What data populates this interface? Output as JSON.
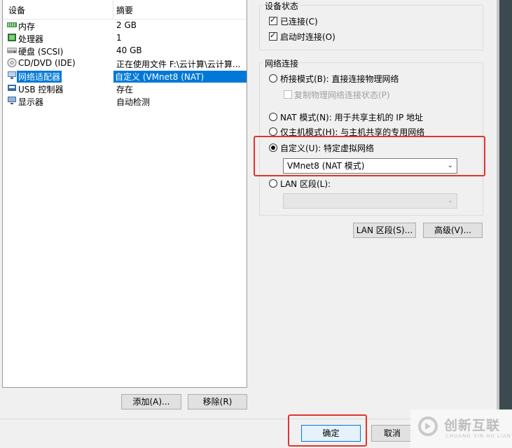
{
  "device_list": {
    "header_device": "设备",
    "header_summary": "摘要",
    "rows": [
      {
        "device": "内存",
        "summary": "2 GB",
        "icon": "memory-icon"
      },
      {
        "device": "处理器",
        "summary": "1",
        "icon": "processor-icon"
      },
      {
        "device": "硬盘 (SCSI)",
        "summary": "40 GB",
        "icon": "hard-disk-icon"
      },
      {
        "device": "CD/DVD (IDE)",
        "summary": "正在使用文件 F:\\云计算\\云计算...",
        "icon": "cd-dvd-icon"
      },
      {
        "device": "网络适配器",
        "summary": "自定义 (VMnet8 (NAT)",
        "icon": "network-adapter-icon",
        "selected": true
      },
      {
        "device": "USB 控制器",
        "summary": "存在",
        "icon": "usb-icon"
      },
      {
        "device": "显示器",
        "summary": "自动检测",
        "icon": "display-icon"
      }
    ],
    "add_button": "添加(A)...",
    "remove_button": "移除(R)"
  },
  "device_status": {
    "title": "设备状态",
    "connected": {
      "label": "已连接(C)",
      "checked": true
    },
    "connect_at_power_on": {
      "label": "启动时连接(O)",
      "checked": true
    }
  },
  "network_connection": {
    "title": "网络连接",
    "bridged": {
      "label": "桥接模式(B): 直接连接物理网络",
      "selected": false
    },
    "replicate": {
      "label": "复制物理网络连接状态(P)",
      "checked": false,
      "disabled": true
    },
    "nat": {
      "label": "NAT 模式(N): 用于共享主机的 IP 地址",
      "selected": false
    },
    "host_only": {
      "label": "仅主机模式(H): 与主机共享的专用网络",
      "selected": false
    },
    "custom": {
      "label": "自定义(U): 特定虚拟网络",
      "selected": true
    },
    "custom_select_value": "VMnet8 (NAT 模式)",
    "lan_segment": {
      "label": "LAN 区段(L):",
      "selected": false
    },
    "lan_select_value": ""
  },
  "buttons": {
    "lan_segments": "LAN 区段(S)...",
    "advanced": "高级(V)...",
    "ok": "确定",
    "cancel": "取消"
  },
  "watermark": {
    "brand": "创新互联",
    "sub": "CHUANG XIN HU LIAN"
  },
  "colors": {
    "selection": "#0078d7",
    "highlight_box": "#e0332e"
  }
}
